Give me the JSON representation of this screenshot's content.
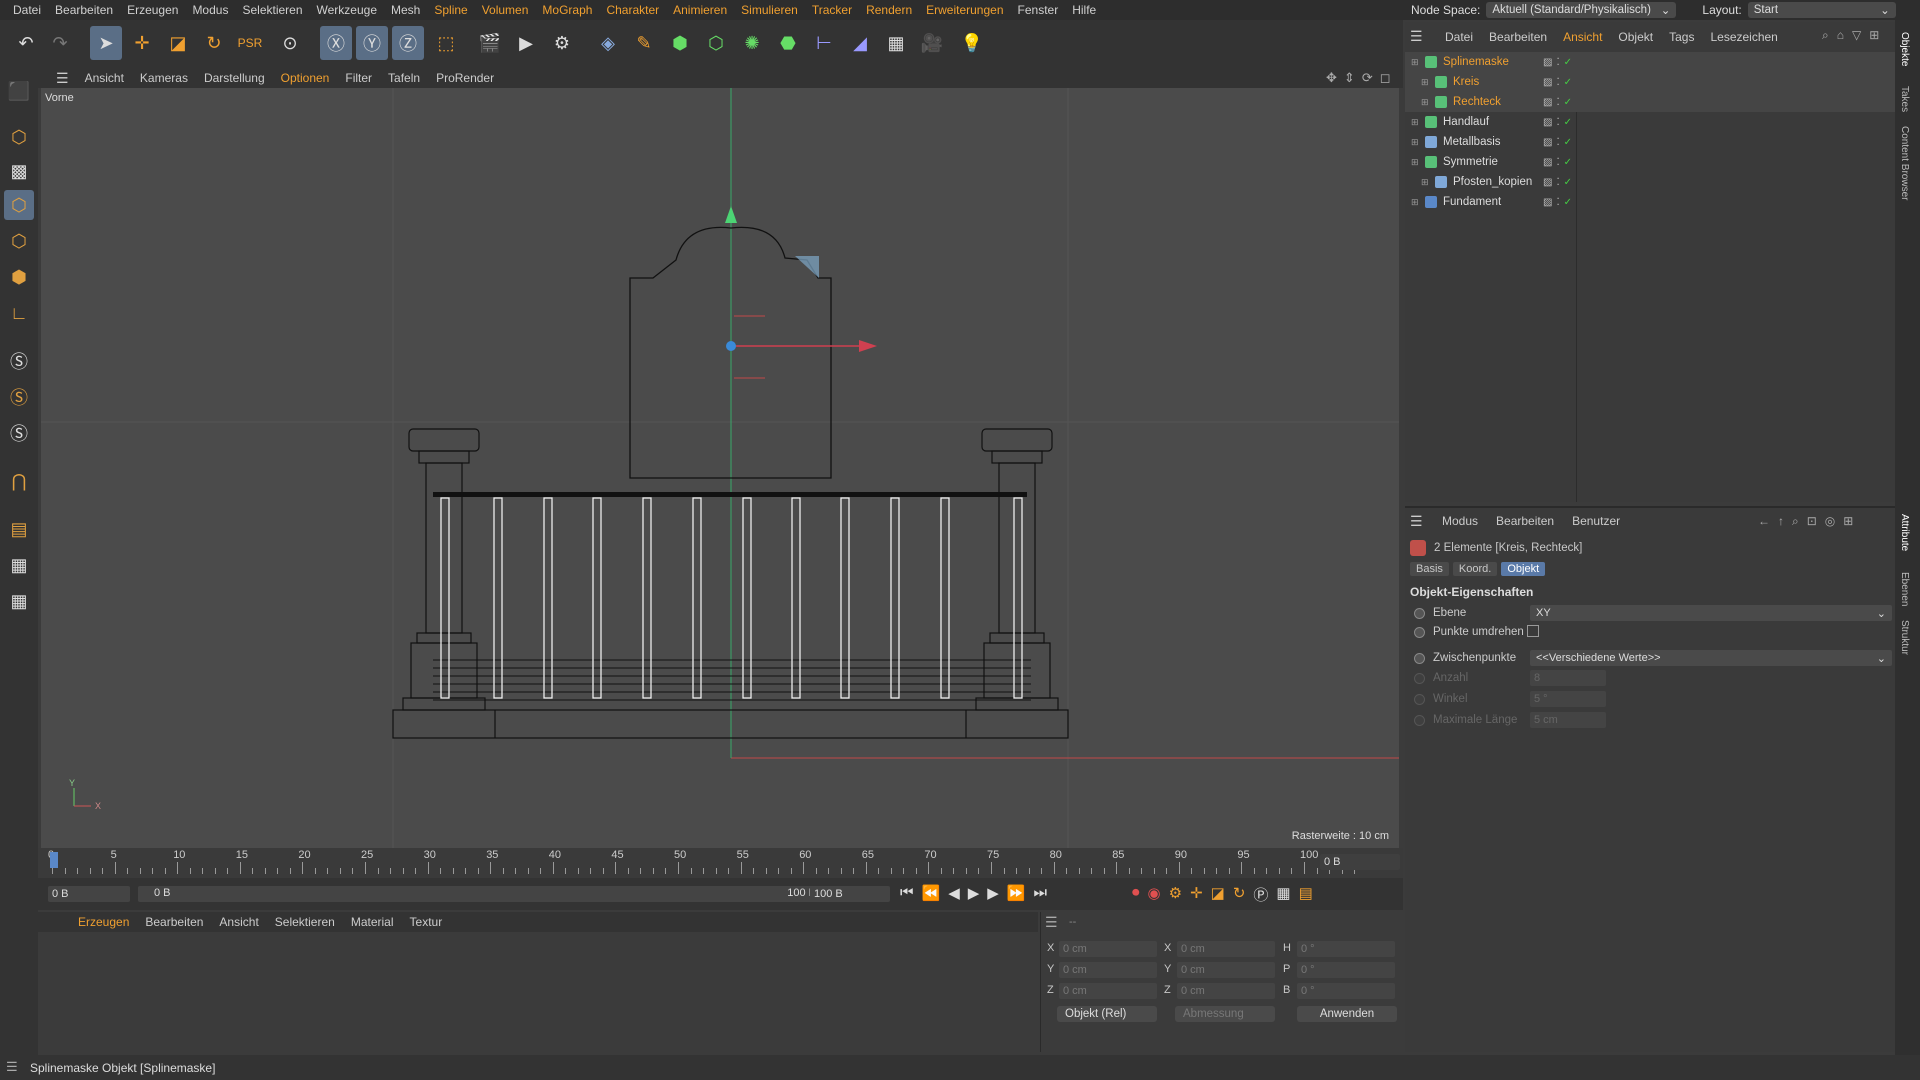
{
  "menubar": {
    "items": [
      "Datei",
      "Bearbeiten",
      "Erzeugen",
      "Modus",
      "Selektieren",
      "Werkzeuge",
      "Mesh",
      "Spline",
      "Volumen",
      "MoGraph",
      "Charakter",
      "Animieren",
      "Simulieren",
      "Tracker",
      "Rendern",
      "Erweiterungen",
      "Fenster",
      "Hilfe"
    ],
    "node_space_label": "Node Space:",
    "node_space_value": "Aktuell (Standard/Physikalisch)",
    "layout_label": "Layout:",
    "layout_value": "Start"
  },
  "viewport": {
    "menu": [
      "Ansicht",
      "Kameras",
      "Darstellung",
      "Optionen",
      "Filter",
      "Tafeln",
      "ProRender"
    ],
    "active_menu": "Optionen",
    "view_name": "Vorne",
    "grid_info": "Rasterweite : 10 cm",
    "axis_y": "Y",
    "axis_x": "X"
  },
  "timeline": {
    "ticks": [
      "0",
      "5",
      "10",
      "15",
      "20",
      "25",
      "30",
      "35",
      "40",
      "45",
      "50",
      "55",
      "60",
      "65",
      "70",
      "75",
      "80",
      "85",
      "90",
      "95",
      "100"
    ],
    "current_frame": "0 B"
  },
  "transport": {
    "start_field": "0 B",
    "range_start": "0 B",
    "range_end": "100 B",
    "end_field": "100 B"
  },
  "material_menu": {
    "items": [
      "Erzeugen",
      "Bearbeiten",
      "Ansicht",
      "Selektieren",
      "Material",
      "Textur"
    ]
  },
  "coords": {
    "pos_x": "0 cm",
    "pos_y": "0 cm",
    "pos_z": "0 cm",
    "size_x": "0 cm",
    "size_y": "0 cm",
    "size_z": "0 cm",
    "rot_h": "0 °",
    "rot_p": "0 °",
    "rot_b": "0 °",
    "label_x": "X",
    "label_y": "Y",
    "label_z": "Z",
    "label_h": "H",
    "label_p": "P",
    "label_b": "B",
    "mode": "Objekt (Rel)",
    "size_mode": "Abmessung",
    "apply": "Anwenden",
    "header_dash": "--"
  },
  "object_manager": {
    "menu": [
      "Datei",
      "Bearbeiten",
      "Ansicht",
      "Objekt",
      "Tags",
      "Lesezeichen"
    ],
    "active_menu": "Ansicht",
    "objects": [
      {
        "name": "Splinemaske",
        "indent": 0,
        "color": "#f0a030",
        "selected": true
      },
      {
        "name": "Kreis",
        "indent": 1,
        "color": "#f0a030",
        "selected": true
      },
      {
        "name": "Rechteck",
        "indent": 1,
        "color": "#f0a030",
        "selected": true
      },
      {
        "name": "Handlauf",
        "indent": 0,
        "color": "#dddddd",
        "selected": false
      },
      {
        "name": "Metallbasis",
        "indent": 0,
        "color": "#dddddd",
        "selected": false
      },
      {
        "name": "Symmetrie",
        "indent": 0,
        "color": "#dddddd",
        "selected": false
      },
      {
        "name": "Pfosten_kopien",
        "indent": 1,
        "color": "#dddddd",
        "selected": false
      },
      {
        "name": "Fundament",
        "indent": 0,
        "color": "#dddddd",
        "selected": false
      }
    ]
  },
  "attributes": {
    "menu": [
      "Modus",
      "Bearbeiten",
      "Benutzer"
    ],
    "selection_info": "2 Elemente [Kreis, Rechteck]",
    "tabs": [
      "Basis",
      "Koord.",
      "Objekt"
    ],
    "active_tab": "Objekt",
    "section_title": "Objekt-Eigenschaften",
    "ebene_label": "Ebene",
    "ebene_value": "XY",
    "punkte_label": "Punkte umdrehen",
    "zwischen_label": "Zwischenpunkte",
    "zwischen_value": "<<Verschiedene Werte>>",
    "anzahl_label": "Anzahl",
    "anzahl_value": "8",
    "winkel_label": "Winkel",
    "winkel_value": "5 °",
    "maxlen_label": "Maximale Länge",
    "maxlen_value": "5 cm"
  },
  "right_strip": {
    "tabs_top": [
      "Objekte",
      "Takes",
      "Content Browser"
    ],
    "tabs_bottom": [
      "Attribute",
      "Ebenen",
      "Struktur"
    ]
  },
  "status": {
    "text": "Splinemaske Objekt [Splinemaske]"
  }
}
